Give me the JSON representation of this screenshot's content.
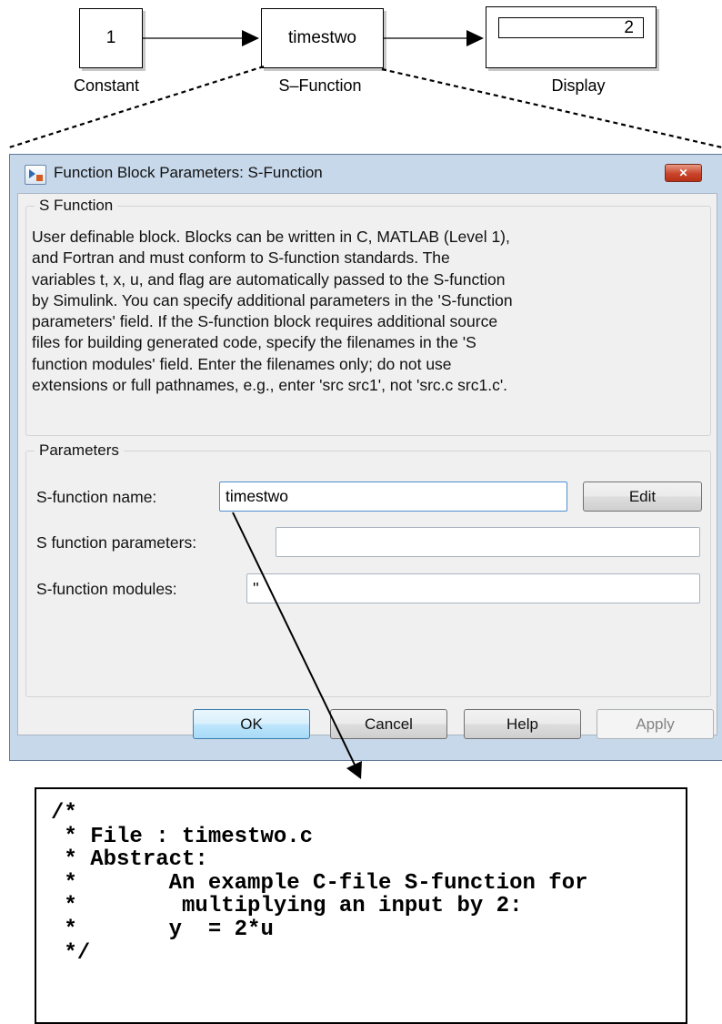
{
  "diagram": {
    "constant": {
      "value": "1",
      "label": "Constant"
    },
    "sfunction": {
      "name": "timestwo",
      "label": "S–Function"
    },
    "display": {
      "value": "2",
      "label": "Display"
    }
  },
  "dialog": {
    "title": "Function Block Parameters: S-Function",
    "close_glyph": "✕",
    "sfunction_group": {
      "legend": "S Function",
      "description": "User definable block.  Blocks can be written in C, MATLAB (Level 1),\nand Fortran and must conform to S-function standards.  The\nvariables t, x, u, and flag are automatically passed to the S-function\nby Simulink.  You can specify additional parameters in the 'S-function\nparameters' field. If the S-function block requires additional source\nfiles for building generated code, specify the filenames in the 'S\nfunction modules' field. Enter the filenames only; do not use\nextensions or full pathnames, e.g., enter 'src src1', not 'src.c src1.c'."
    },
    "parameters_group": {
      "legend": "Parameters",
      "sfunction_name_label": "S-function name:",
      "sfunction_name_value": "timestwo",
      "edit_button": "Edit",
      "sfunction_parameters_label": "S function parameters:",
      "sfunction_parameters_value": "",
      "sfunction_modules_label": "S-function modules:",
      "sfunction_modules_value": "''"
    },
    "buttons": {
      "ok": "OK",
      "cancel": "Cancel",
      "help": "Help",
      "apply": "Apply"
    }
  },
  "code": {
    "text": "/*\n * File : timestwo.c\n * Abstract:\n *       An example C-file S-function for\n *        multiplying an input by 2:\n *       y  = 2*u\n */"
  }
}
